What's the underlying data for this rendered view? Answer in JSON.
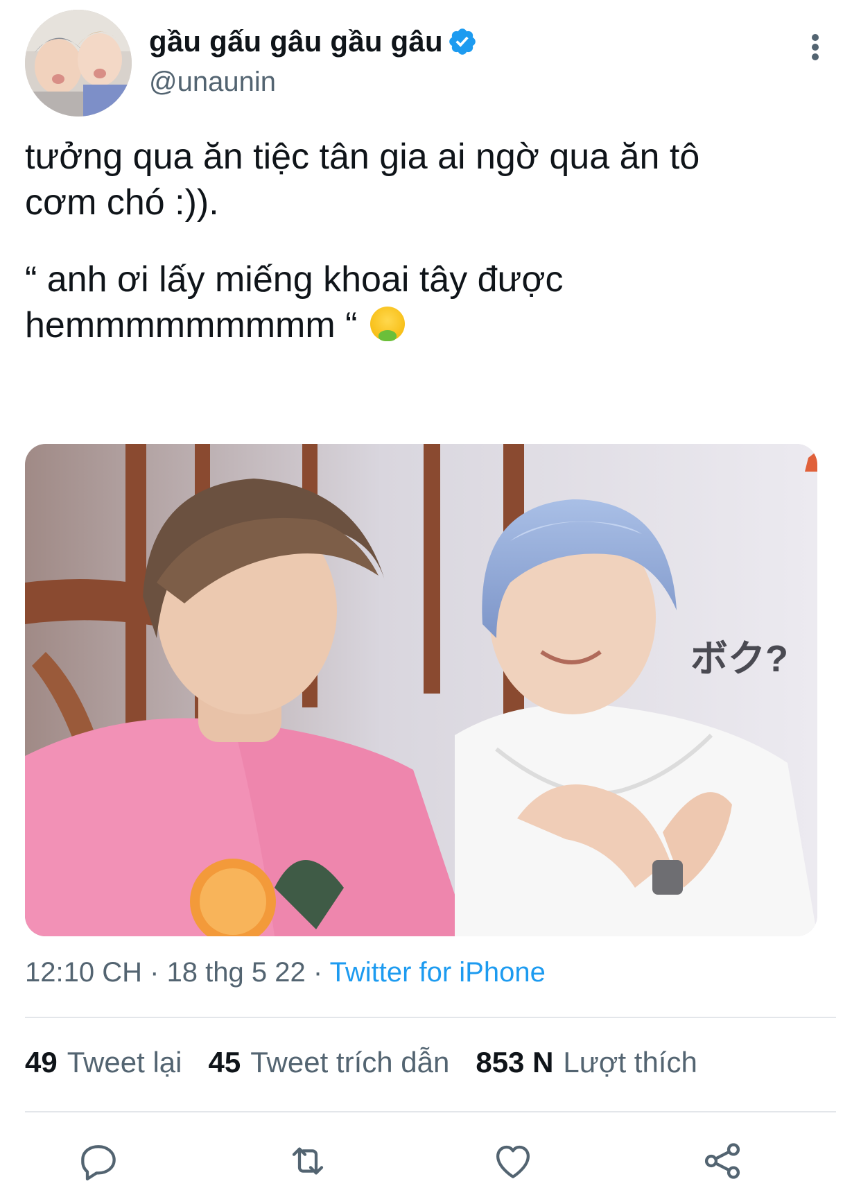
{
  "tweet": {
    "author_name": "gầu gấu gâu gầu gâu",
    "author_handle": "@unaunin",
    "text_line1": "tưởng qua ăn tiệc tân gia ai ngờ qua ăn tô\ncơm chó :)).",
    "text_line2": "“ anh ơi lấy miếng khoai tây được\nhemmmmmmmmm “",
    "emoji_name": "nauseated-face-icon",
    "image_caption": "ボク?",
    "time": "12:10 CH",
    "date": "18 thg 5 22",
    "separator": "·",
    "source": "Twitter for iPhone"
  },
  "stats": {
    "retweets_count": "49",
    "retweets_label": "Tweet lại",
    "quotes_count": "45",
    "quotes_label": "Tweet trích dẫn",
    "likes_count": "853 N",
    "likes_label": "Lượt thích"
  },
  "actions": [
    "reply-icon",
    "retweet-icon",
    "like-icon",
    "share-icon"
  ],
  "colors": {
    "accent": "#1d9bf0",
    "text_primary": "#0f1419",
    "text_secondary": "#536471"
  }
}
